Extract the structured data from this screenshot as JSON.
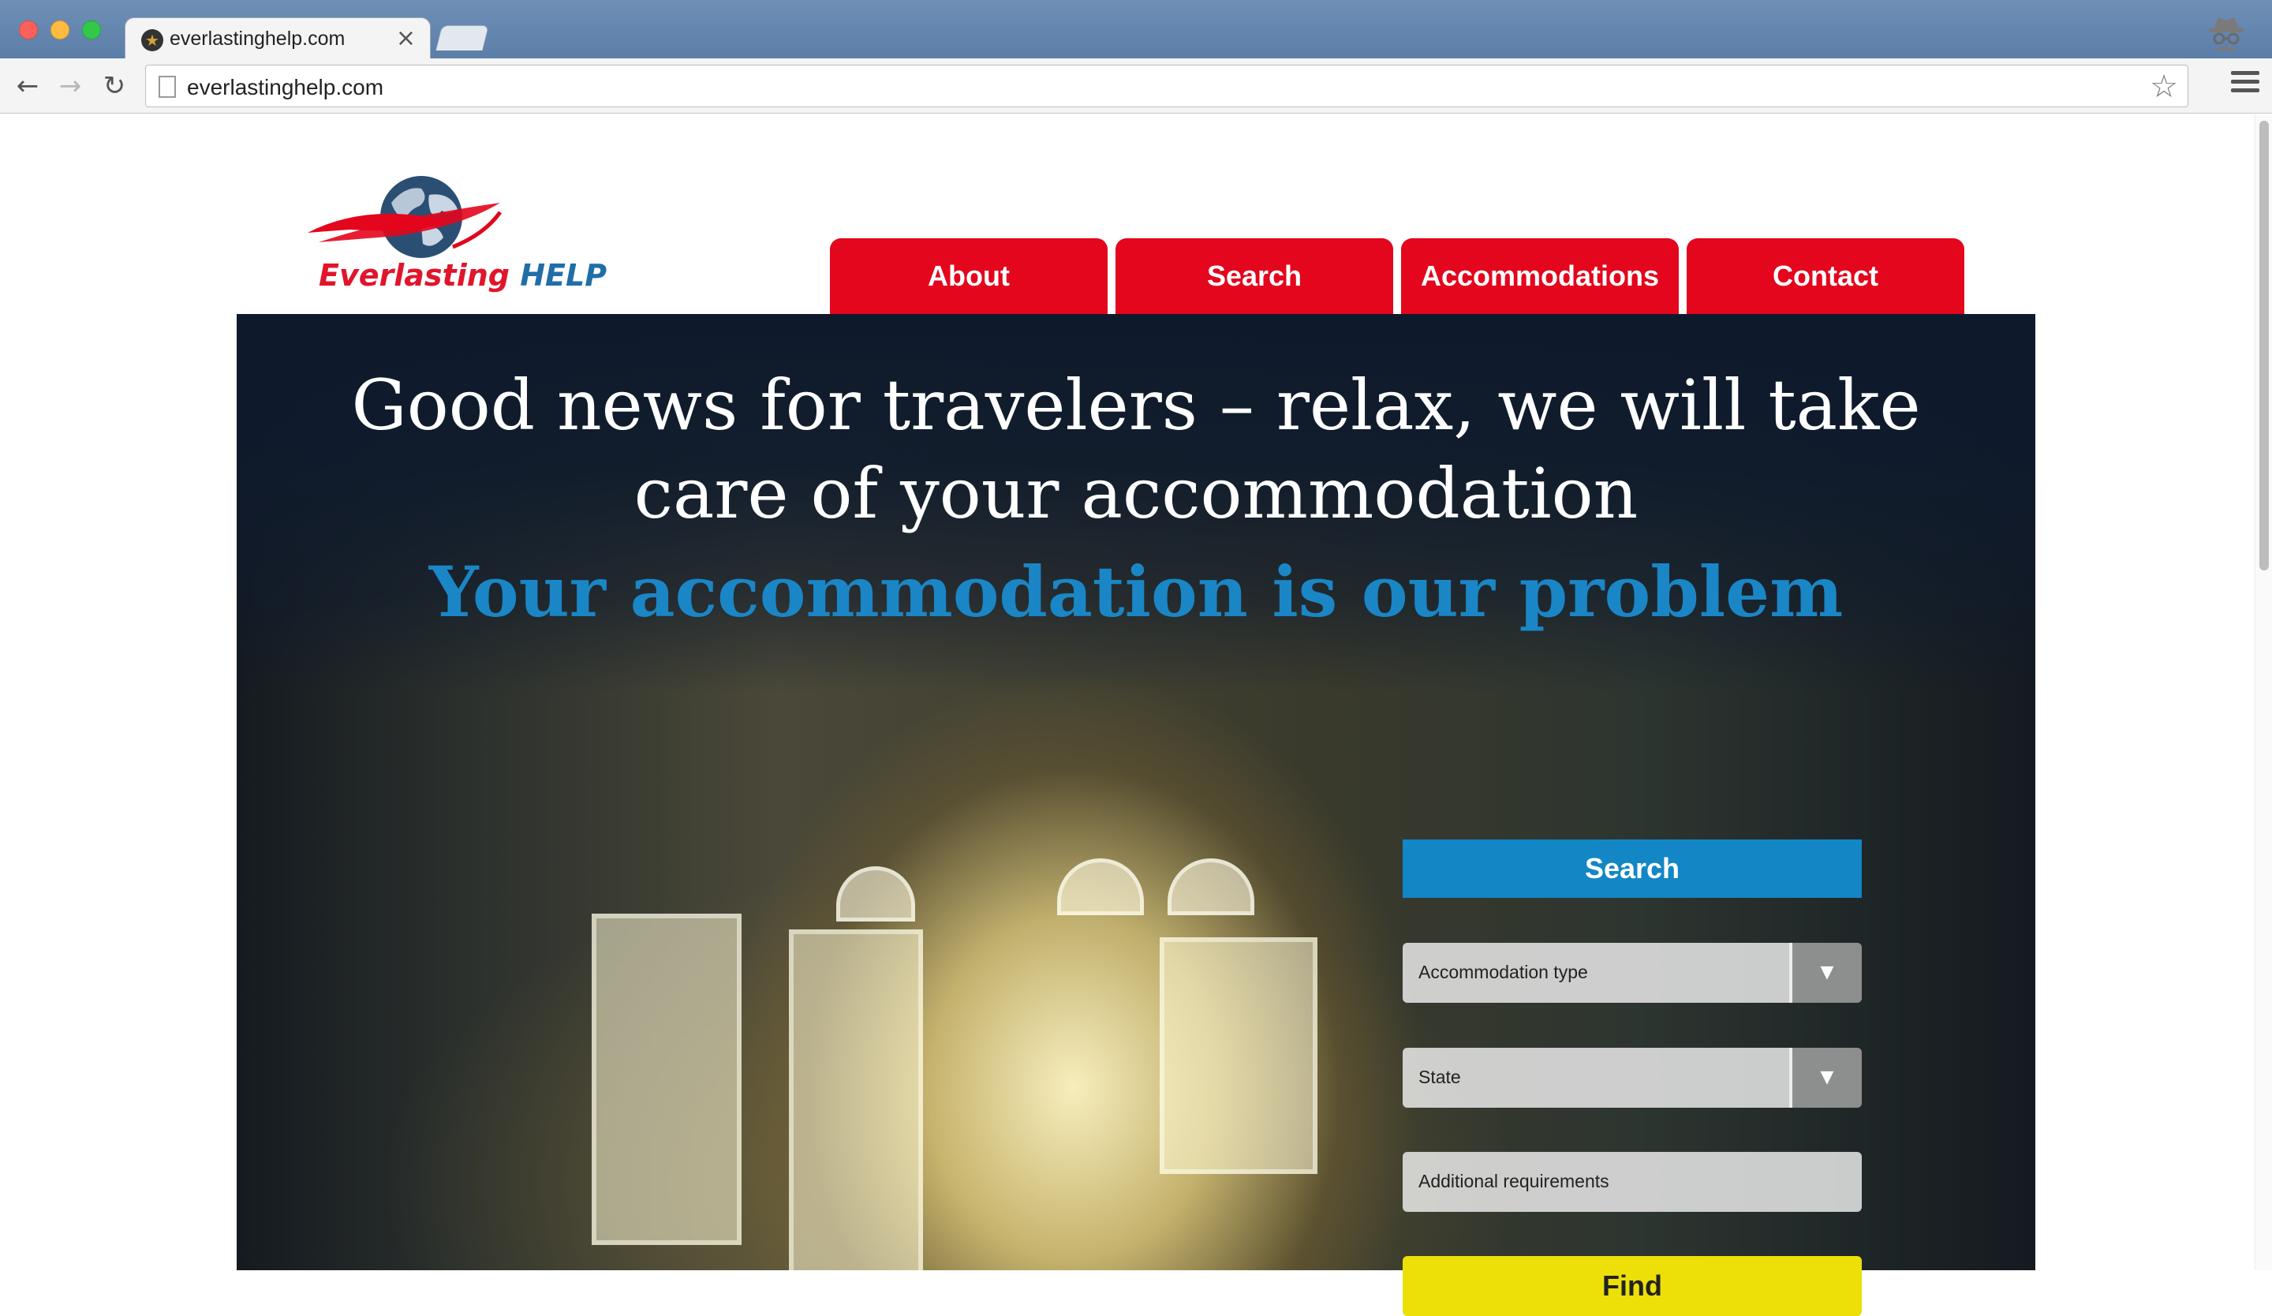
{
  "browser": {
    "tab_title": "everlastinghelp.com",
    "tab_close": "×",
    "url": "everlastinghelp.com",
    "back_icon": "arrow-left-icon",
    "forward_icon": "arrow-right-icon",
    "reload_icon": "reload-icon",
    "bookmark_icon": "star-icon",
    "menu_icon": "hamburger-menu-icon",
    "profile_icon": "incognito-icon"
  },
  "site": {
    "logo": {
      "word1": "Everlasting",
      "word2": "HELP"
    },
    "nav": [
      {
        "label": "About"
      },
      {
        "label": "Search"
      },
      {
        "label": "Accommodations"
      },
      {
        "label": "Contact"
      }
    ],
    "hero": {
      "title_line1": "Good news for travelers – relax, we will take",
      "title_line2": "care of your accommodation",
      "subtitle": "Your accommodation is our problem"
    },
    "search_form": {
      "header": "Search",
      "accommodation_type": "Accommodation type",
      "state": "State",
      "additional_requirements": "Additional requirements",
      "dropdown_arrow": "▼",
      "submit": "Find"
    }
  },
  "colors": {
    "nav_red": "#e3061d",
    "search_blue": "#1386c5",
    "subtitle_blue": "#1a86c6",
    "find_yellow": "#ece008"
  }
}
